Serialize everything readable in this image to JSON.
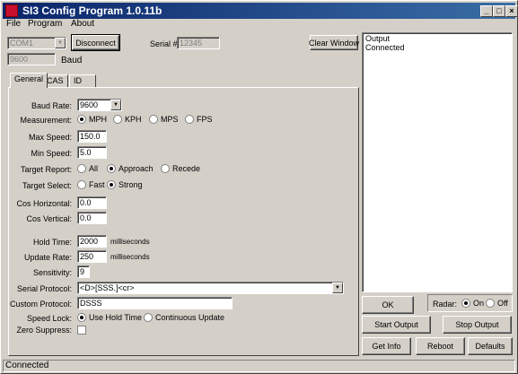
{
  "window": {
    "title": "SI3 Config Program 1.0.11b",
    "minimize": "_",
    "maximize": "□",
    "close": "×"
  },
  "menu": [
    "File",
    "Program",
    "About"
  ],
  "connection": {
    "port": "COM1",
    "disconnect_label": "Disconnect",
    "serial_label": "Serial #",
    "serial_value": "12345",
    "clear_label": "Clear Window",
    "baud_value": "9600",
    "baud_label": "Baud"
  },
  "tabs": [
    "General",
    "CAS",
    "ID"
  ],
  "general": {
    "baud_rate_label": "Baud Rate:",
    "baud_rate_value": "9600",
    "measurement_label": "Measurement:",
    "measurement_options": [
      "MPH",
      "KPH",
      "MPS",
      "FPS"
    ],
    "measurement_selected": "MPH",
    "max_speed_label": "Max Speed:",
    "max_speed_value": "150.0",
    "min_speed_label": "Min Speed:",
    "min_speed_value": "5.0",
    "target_report_label": "Target Report:",
    "target_report_options": [
      "All",
      "Approach",
      "Recede"
    ],
    "target_report_selected": "Approach",
    "target_select_label": "Target Select:",
    "target_select_options": [
      "Fast",
      "Strong"
    ],
    "target_select_selected": "Strong",
    "cos_horizontal_label": "Cos Horizontal:",
    "cos_horizontal_value": "0.0",
    "cos_vertical_label": "Cos Vertical:",
    "cos_vertical_value": "0.0",
    "hold_time_label": "Hold Time:",
    "hold_time_value": "2000",
    "hold_time_unit": "milliseconds",
    "update_rate_label": "Update Rate:",
    "update_rate_value": "250",
    "update_rate_unit": "milliseconds",
    "sensitivity_label": "Sensitivity:",
    "sensitivity_value": "9",
    "serial_protocol_label": "Serial Protocol:",
    "serial_protocol_value": "<D>[SSS.]<cr>",
    "custom_protocol_label": "Custom Protocol:",
    "custom_protocol_value": "DSSS",
    "speed_lock_label": "Speed Lock:",
    "speed_lock_options": [
      "Use Hold Time",
      "Continuous Update"
    ],
    "speed_lock_selected": "Use Hold Time",
    "zero_suppress_label": "Zero Suppress:"
  },
  "output": {
    "lines": [
      "Output",
      "Connected"
    ]
  },
  "actions": {
    "ok_label": "OK",
    "radar_label": "Radar:",
    "radar_on": "On",
    "radar_off": "Off",
    "radar_selected": "On",
    "start_output": "Start Output",
    "stop_output": "Stop Output",
    "get_info": "Get Info",
    "reboot": "Reboot",
    "defaults": "Defaults"
  },
  "status": "Connected"
}
